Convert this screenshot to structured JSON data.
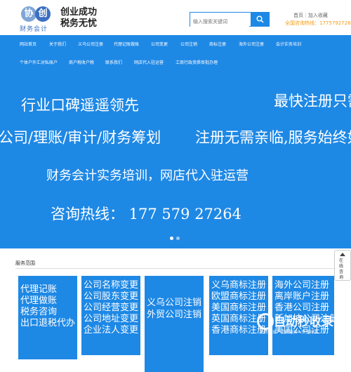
{
  "header": {
    "logo_left": "协",
    "logo_right": "创",
    "logo_sub": "财务会计",
    "slogan_line1": "创业成功",
    "slogan_line2": "税务无忧",
    "search_placeholder": "输入搜索关键词",
    "link_home": "首页",
    "link_favorite": "加入收藏",
    "phone": "全国咨询热线：17757927264"
  },
  "nav": {
    "row1": [
      "网站首页",
      "关于我们",
      "义乌公司注册",
      "代理记账做账",
      "公司变更",
      "公司注销",
      "商标注册",
      "海外公司注册",
      "会计实务培训"
    ],
    "row2": [
      "个体户外汇对私账户",
      "商户税收户税",
      "联系我们",
      "网店代入驻运营",
      "工商行政资质审批办理"
    ]
  },
  "banner": {
    "line1": "行业口碑遥遥领先",
    "line2": "最快注册只需",
    "line3": "公司/理账/审计/财务筹划",
    "line4": "注册无需亲临,服务始终如",
    "line5": "财务会计实务培训，网店代入驻运营",
    "line6": "咨询热线： 177 579 27264"
  },
  "services": {
    "title": "服务范围",
    "cards": [
      [
        "代理记账",
        "代理做账",
        "税务咨询",
        "出口退税代办"
      ],
      [
        "公司名称变更",
        "公司股东变更",
        "公司经营变更",
        "公司地址变更",
        "企业法人变更"
      ],
      [
        "义乌公司注销",
        "外贸公司注销"
      ],
      [
        "义乌商标注册",
        "欧盟商标注册",
        "美国商标注册",
        "英国商标注册",
        "香港商标注册"
      ],
      [
        "海外公司注册",
        "离岸账户注册",
        "香港公司注册",
        "新加坡公司注册",
        "美国公司注册"
      ]
    ]
  },
  "side": {
    "label": "在线咨询"
  },
  "watermark": {
    "title": "自动秒收录",
    "sub": "免费收录 · 优质链接 · 快速排名"
  },
  "colors": {
    "brand_blue": "#1e88e5",
    "phone_orange": "#f39c12"
  }
}
